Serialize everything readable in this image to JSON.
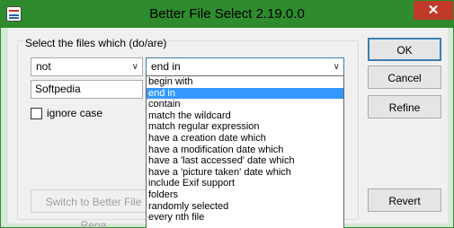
{
  "window": {
    "title": "Better File Select 2.19.0.0",
    "close_glyph": "✕"
  },
  "group": {
    "label": "Select the files which (do/are)"
  },
  "selects": {
    "negation": {
      "value": "not",
      "icon": "chevron-down-icon"
    },
    "condition": {
      "value": "end in",
      "icon": "chevron-down-icon"
    }
  },
  "pattern_input": {
    "value": "Softpedia"
  },
  "ignore_case": {
    "label": "ignore case",
    "checked": false
  },
  "switch_button": {
    "label": "Switch to Better File Rena"
  },
  "buttons": {
    "ok": "OK",
    "cancel": "Cancel",
    "refine": "Refine",
    "revert": "Revert"
  },
  "dropdown": {
    "selected_index": 1,
    "options": [
      "begin with",
      "end in",
      "contain",
      "match the wildcard",
      "match regular expression",
      "have a creation date which",
      "have a modification date which",
      "have a 'last accessed' date which",
      "have a 'picture taken' date which",
      "include Exif support",
      "folders",
      "randomly selected",
      "every nth file"
    ]
  }
}
